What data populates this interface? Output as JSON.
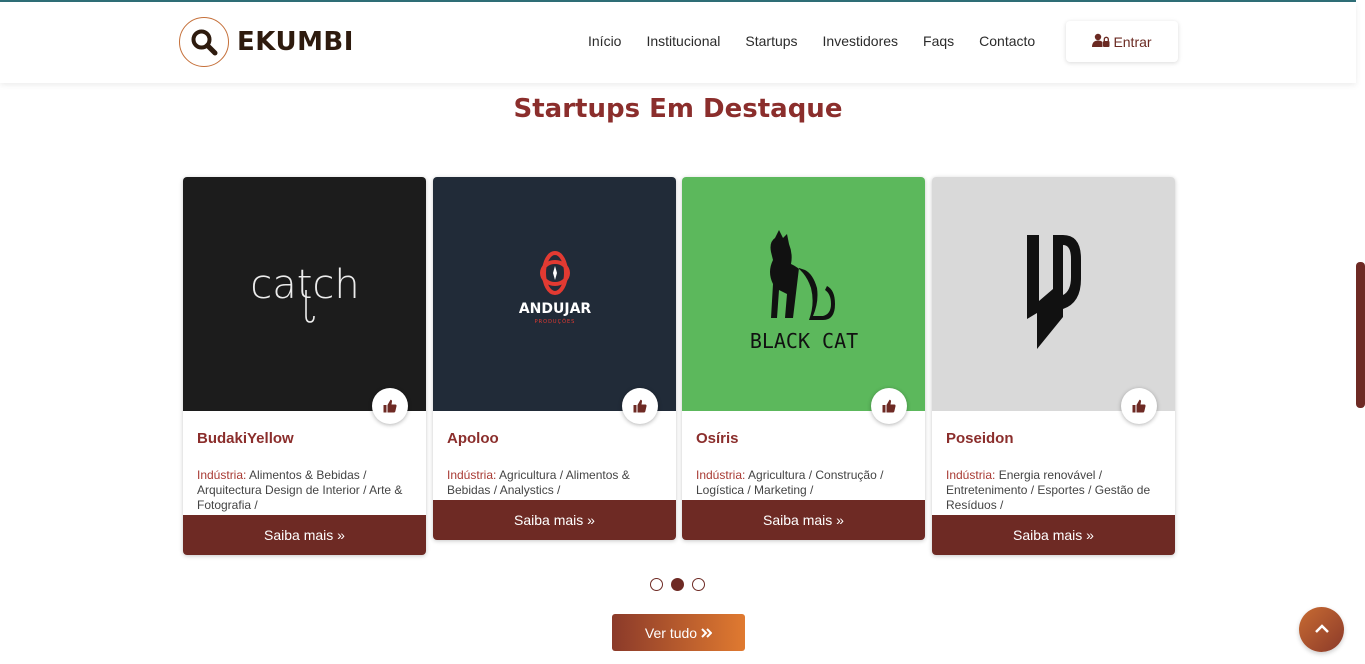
{
  "brand": {
    "name": "EKUMBI"
  },
  "nav": {
    "items": [
      "Início",
      "Institucional",
      "Startups",
      "Investidores",
      "Faqs",
      "Contacto"
    ],
    "login_label": "Entrar"
  },
  "section": {
    "title": "Startups Em Destaque"
  },
  "cards": [
    {
      "name": "BudakiYellow",
      "industry_label": "Indústria:",
      "industry": "Alimentos & Bebidas / Arquitectura Design de Interior / Arte & Fotografia /",
      "more": "Saiba mais  »",
      "logo_text": "catch",
      "bg": "#1c1c1c"
    },
    {
      "name": "Apoloo",
      "industry_label": "Indústria:",
      "industry": "Agricultura / Alimentos & Bebidas / Analystics /",
      "more": "Saiba mais  »",
      "logo_text": "ANDUJAR",
      "logo_sub": "PRODUÇÕES",
      "bg": "#212b38"
    },
    {
      "name": "Osíris",
      "industry_label": "Indústria:",
      "industry": "Agricultura / Construção / Logística / Marketing /",
      "more": "Saiba mais  »",
      "logo_text": "BLACK CAT",
      "bg": "#5cb85c"
    },
    {
      "name": "Poseidon",
      "industry_label": "Indústria:",
      "industry": "Energia renovável / Entretenimento / Esportes / Gestão de Resíduos /",
      "more": "Saiba mais  »",
      "logo_text": "",
      "bg": "#d9d9d9"
    }
  ],
  "carousel": {
    "pages": 3,
    "active": 2
  },
  "actions": {
    "view_all": "Ver tudo"
  },
  "colors": {
    "brand_dark": "#6e2a24",
    "title": "#8b2e2c",
    "accent": "#e07a30"
  },
  "icons": [
    "search-icon",
    "user-lock-icon",
    "thumbs-up-icon",
    "double-chevron-right-icon",
    "chevron-up-icon"
  ]
}
